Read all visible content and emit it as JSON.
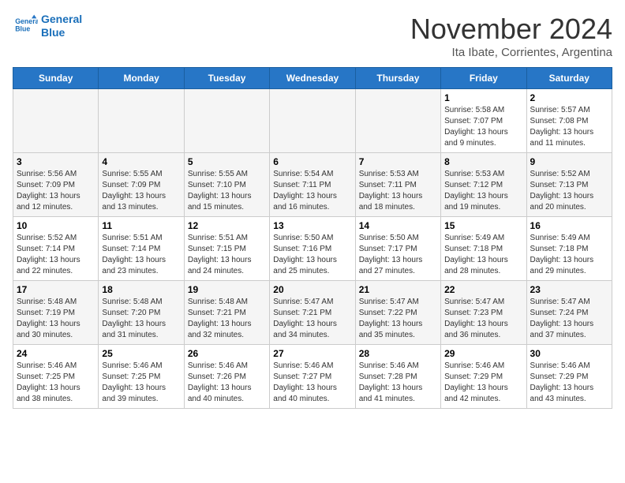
{
  "app": {
    "name": "GeneralBlue",
    "logo_text_line1": "General",
    "logo_text_line2": "Blue"
  },
  "title": "November 2024",
  "location": "Ita Ibate, Corrientes, Argentina",
  "days_of_week": [
    "Sunday",
    "Monday",
    "Tuesday",
    "Wednesday",
    "Thursday",
    "Friday",
    "Saturday"
  ],
  "weeks": [
    [
      {
        "day": null
      },
      {
        "day": null
      },
      {
        "day": null
      },
      {
        "day": null
      },
      {
        "day": null
      },
      {
        "day": "1",
        "sunrise": "5:58 AM",
        "sunset": "7:07 PM",
        "daylight": "13 hours and 9 minutes."
      },
      {
        "day": "2",
        "sunrise": "5:57 AM",
        "sunset": "7:08 PM",
        "daylight": "13 hours and 11 minutes."
      }
    ],
    [
      {
        "day": "3",
        "sunrise": "5:56 AM",
        "sunset": "7:09 PM",
        "daylight": "13 hours and 12 minutes."
      },
      {
        "day": "4",
        "sunrise": "5:55 AM",
        "sunset": "7:09 PM",
        "daylight": "13 hours and 13 minutes."
      },
      {
        "day": "5",
        "sunrise": "5:55 AM",
        "sunset": "7:10 PM",
        "daylight": "13 hours and 15 minutes."
      },
      {
        "day": "6",
        "sunrise": "5:54 AM",
        "sunset": "7:11 PM",
        "daylight": "13 hours and 16 minutes."
      },
      {
        "day": "7",
        "sunrise": "5:53 AM",
        "sunset": "7:11 PM",
        "daylight": "13 hours and 18 minutes."
      },
      {
        "day": "8",
        "sunrise": "5:53 AM",
        "sunset": "7:12 PM",
        "daylight": "13 hours and 19 minutes."
      },
      {
        "day": "9",
        "sunrise": "5:52 AM",
        "sunset": "7:13 PM",
        "daylight": "13 hours and 20 minutes."
      }
    ],
    [
      {
        "day": "10",
        "sunrise": "5:52 AM",
        "sunset": "7:14 PM",
        "daylight": "13 hours and 22 minutes."
      },
      {
        "day": "11",
        "sunrise": "5:51 AM",
        "sunset": "7:14 PM",
        "daylight": "13 hours and 23 minutes."
      },
      {
        "day": "12",
        "sunrise": "5:51 AM",
        "sunset": "7:15 PM",
        "daylight": "13 hours and 24 minutes."
      },
      {
        "day": "13",
        "sunrise": "5:50 AM",
        "sunset": "7:16 PM",
        "daylight": "13 hours and 25 minutes."
      },
      {
        "day": "14",
        "sunrise": "5:50 AM",
        "sunset": "7:17 PM",
        "daylight": "13 hours and 27 minutes."
      },
      {
        "day": "15",
        "sunrise": "5:49 AM",
        "sunset": "7:18 PM",
        "daylight": "13 hours and 28 minutes."
      },
      {
        "day": "16",
        "sunrise": "5:49 AM",
        "sunset": "7:18 PM",
        "daylight": "13 hours and 29 minutes."
      }
    ],
    [
      {
        "day": "17",
        "sunrise": "5:48 AM",
        "sunset": "7:19 PM",
        "daylight": "13 hours and 30 minutes."
      },
      {
        "day": "18",
        "sunrise": "5:48 AM",
        "sunset": "7:20 PM",
        "daylight": "13 hours and 31 minutes."
      },
      {
        "day": "19",
        "sunrise": "5:48 AM",
        "sunset": "7:21 PM",
        "daylight": "13 hours and 32 minutes."
      },
      {
        "day": "20",
        "sunrise": "5:47 AM",
        "sunset": "7:21 PM",
        "daylight": "13 hours and 34 minutes."
      },
      {
        "day": "21",
        "sunrise": "5:47 AM",
        "sunset": "7:22 PM",
        "daylight": "13 hours and 35 minutes."
      },
      {
        "day": "22",
        "sunrise": "5:47 AM",
        "sunset": "7:23 PM",
        "daylight": "13 hours and 36 minutes."
      },
      {
        "day": "23",
        "sunrise": "5:47 AM",
        "sunset": "7:24 PM",
        "daylight": "13 hours and 37 minutes."
      }
    ],
    [
      {
        "day": "24",
        "sunrise": "5:46 AM",
        "sunset": "7:25 PM",
        "daylight": "13 hours and 38 minutes."
      },
      {
        "day": "25",
        "sunrise": "5:46 AM",
        "sunset": "7:25 PM",
        "daylight": "13 hours and 39 minutes."
      },
      {
        "day": "26",
        "sunrise": "5:46 AM",
        "sunset": "7:26 PM",
        "daylight": "13 hours and 40 minutes."
      },
      {
        "day": "27",
        "sunrise": "5:46 AM",
        "sunset": "7:27 PM",
        "daylight": "13 hours and 40 minutes."
      },
      {
        "day": "28",
        "sunrise": "5:46 AM",
        "sunset": "7:28 PM",
        "daylight": "13 hours and 41 minutes."
      },
      {
        "day": "29",
        "sunrise": "5:46 AM",
        "sunset": "7:29 PM",
        "daylight": "13 hours and 42 minutes."
      },
      {
        "day": "30",
        "sunrise": "5:46 AM",
        "sunset": "7:29 PM",
        "daylight": "13 hours and 43 minutes."
      }
    ]
  ]
}
